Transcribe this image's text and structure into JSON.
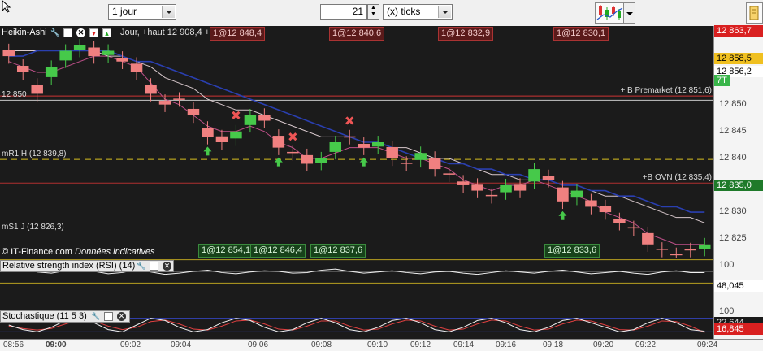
{
  "toolbar": {
    "period": "1 jour",
    "units_value": "21",
    "units_type": "(x) ticks"
  },
  "main": {
    "title_left": "Heikin-Ashi",
    "title_overlay": "Jour, +haut 12 908,4 +bas 12 837,6",
    "watermark": "© IT-Finance.com",
    "watermark_note": "Données indicatives",
    "trade_tags_top": [
      {
        "text": "1@12 848,4",
        "color": "red"
      },
      {
        "text": "1@12 840,6",
        "color": "red"
      },
      {
        "text": "1@12 832,9",
        "color": "red"
      },
      {
        "text": "1@12 830,1",
        "color": "red"
      }
    ],
    "trade_tags_bottom": [
      {
        "text": "1@12 854,1",
        "color": "green"
      },
      {
        "text": "1@12 846,4",
        "color": "green"
      },
      {
        "text": "1@12 837,6",
        "color": "green"
      },
      {
        "text": "1@12 833,6",
        "color": "green"
      }
    ],
    "levels": [
      {
        "label": "12 850",
        "price": 12850.8,
        "color": "#c8c8c8",
        "style": "solid"
      },
      {
        "label": "+ B Premarket (12 851,6)",
        "price": 12851.6,
        "color": "#cc3333",
        "style": "solid"
      },
      {
        "label": "mR1 H (12 839,8)",
        "price": 12839.8,
        "color": "#d8c020",
        "style": "dashed"
      },
      {
        "label": "+B OVN (12 835,4)",
        "price": 12835.4,
        "color": "#b03030",
        "style": "solid"
      },
      {
        "label": "mS1 J (12 826,3)",
        "price": 12826.3,
        "color": "#c08020",
        "style": "dashed"
      }
    ],
    "price_labels": [
      {
        "text": "12 863,7",
        "price": 12863.7,
        "bg": "#d92020",
        "fg": "#ffffff"
      },
      {
        "text": "12 858,5",
        "price": 12858.5,
        "bg": "#f0c020",
        "fg": "#000000"
      },
      {
        "text": "12 856,2",
        "price": 12856.2,
        "bg": "#ffffff",
        "fg": "#000000"
      },
      {
        "text": "7T",
        "price": 12854.5,
        "bg": "#39b54a",
        "fg": "#ffffff"
      },
      {
        "text": "12 835,0",
        "price": 12835.0,
        "bg": "#1f7a2a",
        "fg": "#ffffff"
      }
    ],
    "y_ticks": [
      "12 850",
      "12 845",
      "12 840",
      "12 835",
      "12 830",
      "12 825"
    ]
  },
  "rsi": {
    "title": "Relative strength index (RSI) (14)",
    "value": "48,045",
    "tick": "100"
  },
  "stoch": {
    "title": "Stochastique (11 5 3)",
    "value1": "22,644",
    "value2": "16,845",
    "tick": "100"
  },
  "x_ticks": [
    "08:56",
    "09:00",
    "09:02",
    "09:04",
    "09:06",
    "09:08",
    "09:10",
    "09:12",
    "09:14",
    "09:16",
    "09:18",
    "09:20",
    "09:22",
    "09:24"
  ],
  "chart_data": {
    "type": "candlestick",
    "series": [
      {
        "name": "Heikin-Ashi",
        "close": [
          12859,
          12856,
          12852,
          12857,
          12860,
          12861,
          12859,
          12860,
          12858,
          12856,
          12852,
          12850,
          12851,
          12848,
          12844,
          12843,
          12845,
          12848,
          12847,
          12842,
          12841,
          12839,
          12840,
          12843,
          12844,
          12842,
          12843,
          12840,
          12839,
          12841,
          12838,
          12837,
          12835,
          12834,
          12833,
          12835,
          12834,
          12838,
          12836,
          12832,
          12834,
          12831,
          12830,
          12828,
          12827,
          12824,
          12823,
          12822,
          12823,
          12824
        ]
      },
      {
        "name": "MA rapide",
        "values": [
          12858,
          12857,
          12856,
          12856,
          12857,
          12858,
          12859,
          12859,
          12858,
          12857,
          12854,
          12851,
          12850,
          12848,
          12846,
          12845,
          12845,
          12846,
          12845,
          12843,
          12842,
          12840,
          12840,
          12841,
          12842,
          12842,
          12842,
          12841,
          12840,
          12840,
          12839,
          12838,
          12836,
          12835,
          12834,
          12835,
          12835,
          12836,
          12835,
          12834,
          12833,
          12832,
          12830,
          12829,
          12828,
          12826,
          12825,
          12824,
          12824,
          12824
        ]
      },
      {
        "name": "MA moyenne",
        "values": [
          12860,
          12860,
          12860,
          12860,
          12860,
          12860,
          12860,
          12859,
          12859,
          12858,
          12857,
          12855,
          12854,
          12853,
          12851,
          12850,
          12849,
          12849,
          12848,
          12847,
          12846,
          12845,
          12844,
          12844,
          12844,
          12843,
          12843,
          12842,
          12842,
          12841,
          12840,
          12840,
          12839,
          12838,
          12837,
          12837,
          12836,
          12836,
          12836,
          12835,
          12835,
          12834,
          12833,
          12833,
          12832,
          12831,
          12830,
          12829,
          12829,
          12828
        ]
      },
      {
        "name": "MA lente",
        "values": [
          12859,
          12859,
          12860,
          12860,
          12860,
          12860,
          12860,
          12860,
          12859,
          12858,
          12858,
          12857,
          12856,
          12855,
          12854,
          12853,
          12852,
          12851,
          12850,
          12849,
          12848,
          12847,
          12846,
          12845,
          12844,
          12843,
          12843,
          12842,
          12841,
          12840,
          12840,
          12839,
          12839,
          12838,
          12838,
          12837,
          12837,
          12836,
          12836,
          12835,
          12835,
          12834,
          12834,
          12833,
          12833,
          12832,
          12831,
          12831,
          12830,
          12830
        ]
      }
    ],
    "ylim": [
      12822,
      12864
    ],
    "rsi": [
      52,
      55,
      49,
      47,
      51,
      54,
      50,
      46,
      48,
      53,
      49,
      45,
      47,
      50,
      52,
      48,
      46,
      49,
      51,
      50,
      47,
      48,
      52,
      54,
      50,
      47,
      49,
      51,
      48,
      46,
      49,
      50,
      47,
      45,
      48,
      51,
      49,
      47,
      50,
      52,
      49,
      46,
      48,
      50,
      47,
      45,
      49,
      51,
      48,
      48
    ],
    "stoch_k": [
      50,
      30,
      20,
      40,
      70,
      80,
      60,
      30,
      20,
      50,
      80,
      70,
      40,
      20,
      30,
      60,
      80,
      70,
      40,
      20,
      30,
      60,
      80,
      60,
      30,
      20,
      40,
      70,
      80,
      60,
      30,
      20,
      40,
      70,
      80,
      60,
      30,
      20,
      40,
      70,
      80,
      60,
      40,
      20,
      30,
      60,
      80,
      60,
      30,
      23
    ],
    "stoch_d": [
      45,
      35,
      28,
      35,
      55,
      72,
      68,
      45,
      30,
      40,
      65,
      72,
      55,
      32,
      28,
      45,
      68,
      72,
      55,
      32,
      28,
      45,
      68,
      68,
      45,
      28,
      32,
      55,
      72,
      68,
      45,
      28,
      32,
      55,
      72,
      68,
      45,
      28,
      32,
      55,
      72,
      68,
      50,
      30,
      28,
      45,
      68,
      65,
      45,
      17
    ]
  }
}
